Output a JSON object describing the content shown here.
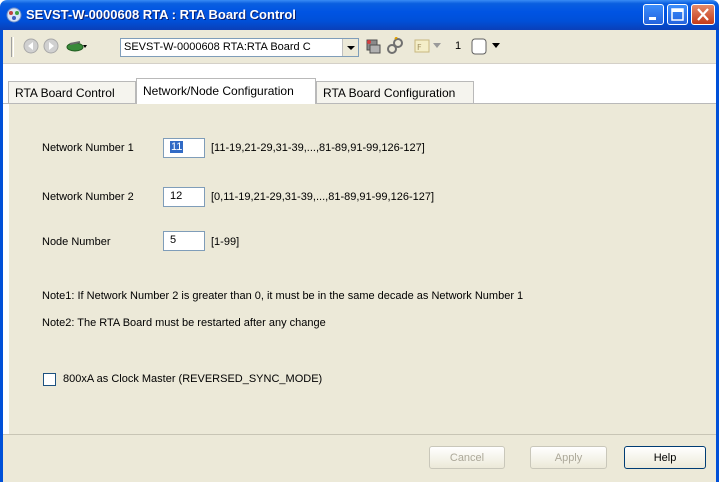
{
  "window": {
    "title": "SEVST-W-0000608 RTA : RTA Board Control"
  },
  "toolbar": {
    "location_value": "SEVST-W-0000608 RTA:RTA Board C",
    "page_number": "1",
    "icons": [
      "back-icon",
      "forward-icon",
      "object-icon",
      "refresh-icon",
      "link-icon",
      "function-icon",
      "page-icon"
    ]
  },
  "tabs": [
    {
      "label": "RTA Board Control",
      "active": false
    },
    {
      "label": "Network/Node Configuration",
      "active": true
    },
    {
      "label": "RTA Board Configuration",
      "active": false
    }
  ],
  "form": {
    "network1": {
      "label": "Network Number 1",
      "value": "11",
      "range": "[11-19,21-29,31-39,...,81-89,91-99,126-127]"
    },
    "network2": {
      "label": "Network Number 2",
      "value": "12",
      "range": "[0,11-19,21-29,31-39,...,81-89,91-99,126-127]"
    },
    "node": {
      "label": "Node Number",
      "value": "5",
      "range": "[1-99]"
    },
    "note1": "Note1: If Network Number 2 is greater than 0, it must be in the same decade as Network Number 1",
    "note2": "Note2: The RTA Board must be restarted after any change",
    "clock_master": {
      "label": "800xA as Clock Master (REVERSED_SYNC_MODE)",
      "checked": false
    }
  },
  "buttons": {
    "cancel": "Cancel",
    "apply": "Apply",
    "help": "Help"
  }
}
